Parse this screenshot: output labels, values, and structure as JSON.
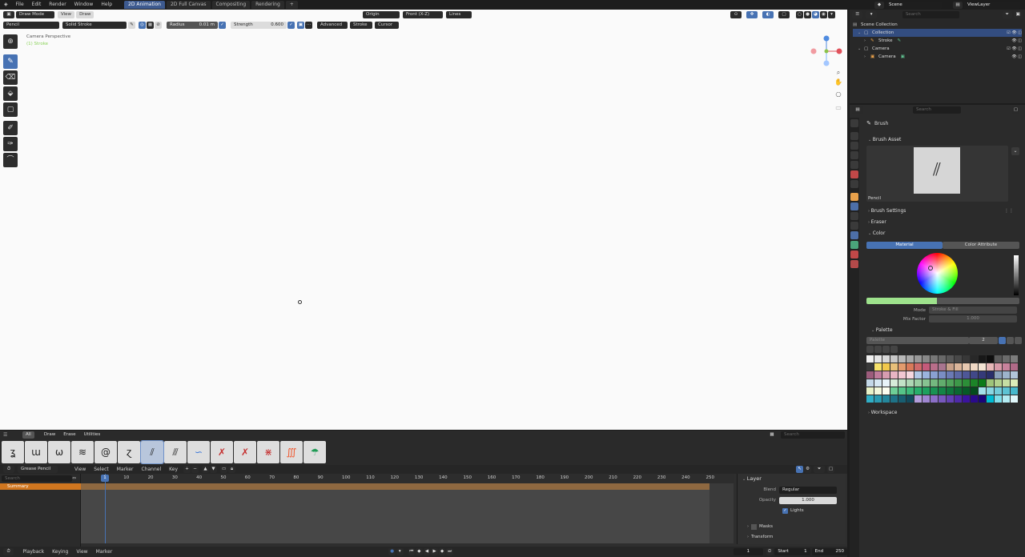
{
  "menu": {
    "items": [
      "File",
      "Edit",
      "Render",
      "Window",
      "Help"
    ]
  },
  "workspace_tabs": [
    "2D Animation",
    "2D Full Canvas",
    "Compositing",
    "Rendering"
  ],
  "workspace_active": "2D Animation",
  "viewport_header": {
    "mode": "Draw Mode",
    "view": "View",
    "draw": "Draw",
    "origin": "Origin",
    "orientation": "Front (X-Z)",
    "lines": "Lines"
  },
  "tool_settings": {
    "brush": "Pencil",
    "stroke": "Solid Stroke",
    "radius_label": "Radius",
    "radius_value": "0.01 m",
    "strength_label": "Strength",
    "strength_value": "0.600",
    "advanced": "Advanced",
    "stroke_menu": "Stroke",
    "cursor_menu": "Cursor"
  },
  "viewport": {
    "camera_label": "Camera Perspective",
    "object_label": "(1) Stroke"
  },
  "brush_shelf": {
    "tabs": [
      "All",
      "Draw",
      "Erase",
      "Utilities"
    ],
    "search_placeholder": "Search"
  },
  "timeline": {
    "header_items": [
      "View",
      "Select",
      "Marker",
      "Channel",
      "Key"
    ],
    "mode": "Grease Pencil",
    "search_placeholder": "Search",
    "summary": "Summary",
    "current_frame": "1",
    "frame_labels": [
      "10",
      "20",
      "30",
      "40",
      "50",
      "60",
      "70",
      "80",
      "90",
      "100",
      "110",
      "120",
      "130",
      "140",
      "150",
      "160",
      "170",
      "180",
      "190",
      "200",
      "210",
      "220",
      "230",
      "240",
      "250"
    ],
    "side_panel": {
      "title": "Layer",
      "blend_label": "Blend",
      "blend_value": "Regular",
      "opacity_label": "Opacity",
      "opacity_value": "1.000",
      "lights_label": "Lights",
      "masks_label": "Masks",
      "transform_label": "Transform"
    }
  },
  "statusbar": {
    "playback": "Playback",
    "keying": "Keying",
    "view": "View",
    "marker": "Marker",
    "frame": "1",
    "start_label": "Start",
    "start_value": "1",
    "end_label": "End",
    "end_value": "250"
  },
  "top_right": {
    "scene": "Scene",
    "view_layer": "ViewLayer"
  },
  "outliner": {
    "search_placeholder": "Search",
    "rows": [
      {
        "label": "Scene Collection"
      },
      {
        "label": "Collection"
      },
      {
        "label": "Stroke"
      },
      {
        "label": "Camera"
      },
      {
        "label": "Camera"
      }
    ]
  },
  "properties": {
    "search_placeholder": "Search",
    "brush_title": "Brush",
    "brush_asset_label": "Brush Asset",
    "brush_name": "Pencil",
    "brush_settings": "Brush Settings",
    "eraser": "Eraser",
    "color": "Color",
    "material_tab": "Material",
    "color_attribute_tab": "Color Attribute",
    "mode_label": "Mode",
    "mode_value": "Stroke & Fill",
    "mix_factor_label": "Mix Factor",
    "mix_factor_value": "1.000",
    "palette_header": "Palette",
    "palette_name": "Palette",
    "palette_users": "2",
    "workspace": "Workspace"
  },
  "colors": {
    "accent": "#4772b3",
    "summary_orange": "#d0761f",
    "viewport_bg": "#fafafa"
  }
}
